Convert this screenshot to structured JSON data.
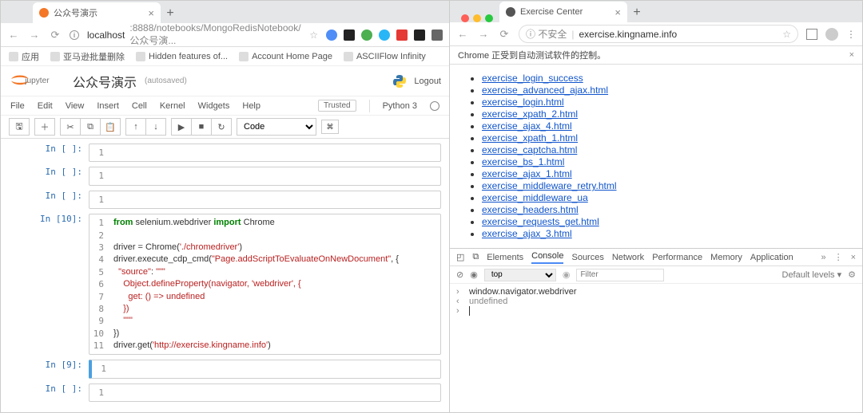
{
  "leftTab": {
    "title": "公众号演示",
    "url_host": "localhost",
    "url_path": ":8888/notebooks/MongoRedisNotebook/公众号演..."
  },
  "bookmarks": [
    {
      "label": "应用"
    },
    {
      "label": "亚马逊批量删除"
    },
    {
      "label": "Hidden features of..."
    },
    {
      "label": "Account Home Page"
    },
    {
      "label": "ASCIIFlow Infinity"
    }
  ],
  "jupyter": {
    "title": "公众号演示",
    "autosave": "(autosaved)",
    "logout": "Logout",
    "menus": [
      "File",
      "Edit",
      "View",
      "Insert",
      "Cell",
      "Kernel",
      "Widgets",
      "Help"
    ],
    "trusted": "Trusted",
    "kernel": "Python 3",
    "celltype": "Code"
  },
  "cells": [
    {
      "prompt": "In [ ]:",
      "code": " "
    },
    {
      "prompt": "In [ ]:",
      "code": " "
    },
    {
      "prompt": "In [ ]:",
      "code": " "
    },
    {
      "prompt": "In [10]:",
      "lines": [
        {
          "n": 1,
          "h": "<span class='k'>from</span> selenium.webdriver <span class='k'>import</span> Chrome"
        },
        {
          "n": 2,
          "h": ""
        },
        {
          "n": 3,
          "h": "driver = Chrome(<span class='s'>'./chromedriver'</span>)"
        },
        {
          "n": 4,
          "h": "driver.execute_cdp_cmd(<span class='s'>\"Page.addScriptToEvaluateOnNewDocument\"</span>, {"
        },
        {
          "n": 5,
          "h": "  <span class='s'>\"source\"</span>: <span class='s'>\"\"\"</span>"
        },
        {
          "n": 6,
          "h": "<span class='s'>    Object.defineProperty(navigator, 'webdriver', {</span>"
        },
        {
          "n": 7,
          "h": "<span class='s'>      get: () =&gt; undefined</span>"
        },
        {
          "n": 8,
          "h": "<span class='s'>    })</span>"
        },
        {
          "n": 9,
          "h": "<span class='s'>    \"\"\"</span>"
        },
        {
          "n": 10,
          "h": "})"
        },
        {
          "n": 11,
          "h": "driver.get(<span class='s'>'http://exercise.kingname.info'</span>)"
        }
      ]
    },
    {
      "prompt": "In [9]:",
      "code": " ",
      "sel": true
    },
    {
      "prompt": "In [ ]:",
      "code": " "
    }
  ],
  "rightTab": {
    "title": "Exercise Center",
    "security": "不安全",
    "url": "exercise.kingname.info"
  },
  "autobar": "Chrome 正受到自动测试软件的控制。",
  "links": [
    "exercise_login_success",
    "exercise_advanced_ajax.html",
    "exercise_login.html",
    "exercise_xpath_2.html",
    "exercise_ajax_4.html",
    "exercise_xpath_1.html",
    "exercise_captcha.html",
    "exercise_bs_1.html",
    "exercise_ajax_1.html",
    "exercise_middleware_retry.html",
    "exercise_middleware_ua",
    "exercise_headers.html",
    "exercise_requests_get.html",
    "exercise_ajax_3.html"
  ],
  "devtools": {
    "tabs": [
      "Elements",
      "Console",
      "Sources",
      "Network",
      "Performance",
      "Memory",
      "Application"
    ],
    "active": "Console",
    "ctx": "top",
    "filter_ph": "Filter",
    "levels": "Default levels ▾",
    "lines": [
      {
        "p": "›",
        "t": "window.navigator.webdriver"
      },
      {
        "p": "‹",
        "t": "undefined",
        "out": true
      },
      {
        "p": "›",
        "t": ""
      }
    ]
  }
}
